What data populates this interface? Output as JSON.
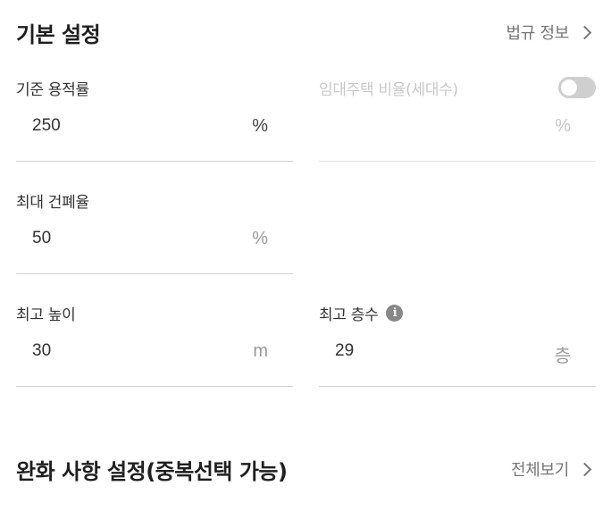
{
  "basic_settings": {
    "title": "기본 설정",
    "link_label": "법규 정보"
  },
  "fields": {
    "base_far": {
      "label": "기준 용적률",
      "value": "250",
      "unit": "%"
    },
    "rental_ratio": {
      "label": "임대주택 비율(세대수)",
      "value": "",
      "unit": "%",
      "toggle_on": false
    },
    "max_bcr": {
      "label": "최대 건폐율",
      "value": "50",
      "unit": "%"
    },
    "max_height": {
      "label": "최고 높이",
      "value": "30",
      "unit": "m"
    },
    "max_floors": {
      "label": "최고 층수",
      "value": "29",
      "unit": "층",
      "info_icon": "info-icon"
    }
  },
  "relaxation": {
    "title": "완화 사항 설정(중복선택 가능)",
    "link_label": "전체보기"
  }
}
